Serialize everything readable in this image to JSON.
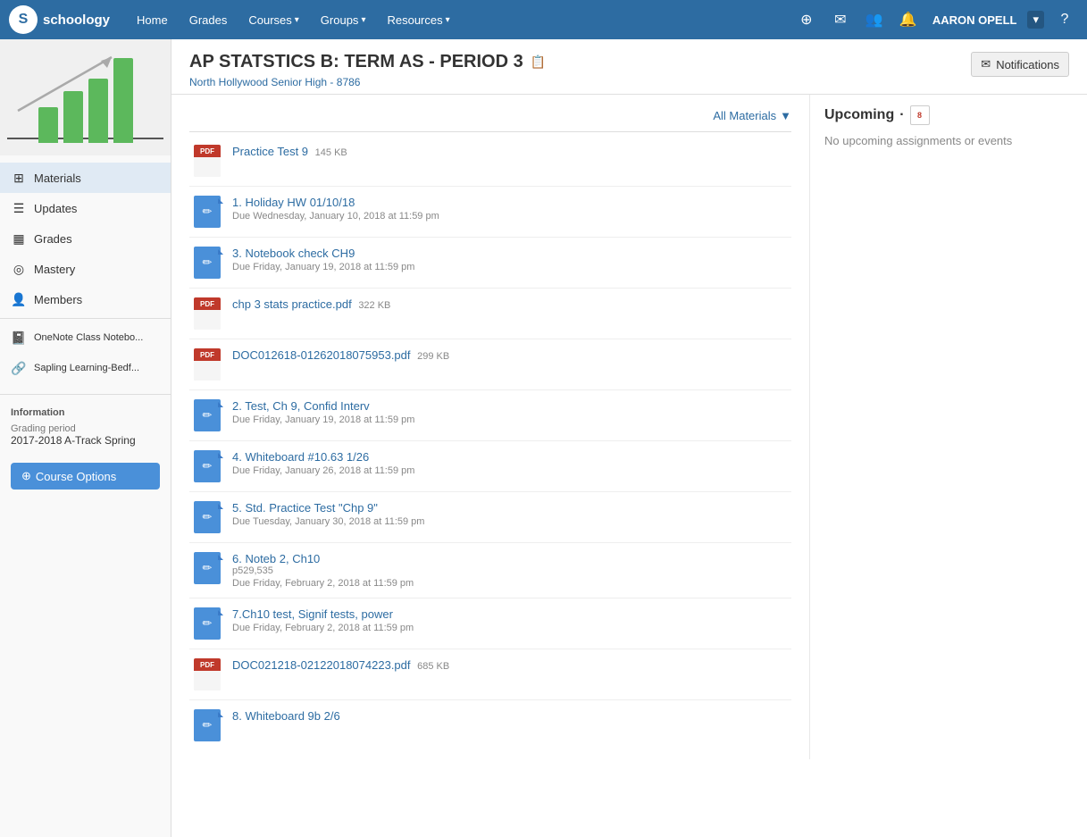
{
  "nav": {
    "logo_text": "schoology",
    "links": [
      {
        "label": "Home",
        "has_dropdown": false
      },
      {
        "label": "Grades",
        "has_dropdown": false
      },
      {
        "label": "Courses",
        "has_dropdown": true
      },
      {
        "label": "Groups",
        "has_dropdown": true
      },
      {
        "label": "Resources",
        "has_dropdown": true
      }
    ],
    "user_name": "AARON OPELL",
    "help_label": "?"
  },
  "course": {
    "title": "AP STATSTICS B: TERM AS - PERIOD 3",
    "school": "North Hollywood Senior High",
    "school_code": "8786",
    "notifications_label": "Notifications"
  },
  "sidebar": {
    "items": [
      {
        "label": "Materials",
        "active": true,
        "icon": "grid"
      },
      {
        "label": "Updates",
        "active": false,
        "icon": "list"
      },
      {
        "label": "Grades",
        "active": false,
        "icon": "table"
      },
      {
        "label": "Mastery",
        "active": false,
        "icon": "circle"
      },
      {
        "label": "Members",
        "active": false,
        "icon": "person"
      },
      {
        "label": "OneNote Class Notebo...",
        "active": false,
        "icon": "note"
      },
      {
        "label": "Sapling Learning-Bedf...",
        "active": false,
        "icon": "link"
      }
    ],
    "info": {
      "label": "Information",
      "grading_period_label": "Grading period",
      "grading_period_value": "2017-2018 A-Track Spring"
    },
    "course_options_label": "Course Options"
  },
  "filter": {
    "label": "All Materials",
    "dropdown_arrow": "▼"
  },
  "materials": [
    {
      "type": "pdf",
      "name": "Practice Test 9",
      "size": "145 KB",
      "due": ""
    },
    {
      "type": "assignment",
      "name": "1. Holiday HW 01/10/18",
      "size": "",
      "due": "Due Wednesday, January 10, 2018 at 11:59 pm"
    },
    {
      "type": "assignment",
      "name": "3. Notebook check CH9",
      "size": "",
      "due": "Due Friday, January 19, 2018 at 11:59 pm"
    },
    {
      "type": "pdf",
      "name": "chp 3 stats practice.pdf",
      "size": "322 KB",
      "due": ""
    },
    {
      "type": "pdf",
      "name": "DOC012618-01262018075953.pdf",
      "size": "299 KB",
      "due": ""
    },
    {
      "type": "assignment",
      "name": "2. Test, Ch 9, Confid Interv",
      "size": "",
      "due": "Due Friday, January 19, 2018 at 11:59 pm"
    },
    {
      "type": "assignment",
      "name": "4. Whiteboard #10.63 1/26",
      "size": "",
      "due": "Due Friday, January 26, 2018 at 11:59 pm"
    },
    {
      "type": "assignment",
      "name": "5. Std. Practice Test \"Chp 9\"",
      "size": "",
      "due": "Due Tuesday, January 30, 2018 at 11:59 pm"
    },
    {
      "type": "assignment",
      "name": "6. Noteb 2, Ch10",
      "size": "",
      "note": "p529,535",
      "due": "Due Friday, February 2, 2018 at 11:59 pm"
    },
    {
      "type": "assignment",
      "name": "7.Ch10 test, Signif tests, power",
      "size": "",
      "due": "Due Friday, February 2, 2018 at 11:59 pm"
    },
    {
      "type": "pdf",
      "name": "DOC021218-02122018074223.pdf",
      "size": "685 KB",
      "due": ""
    },
    {
      "type": "assignment",
      "name": "8. Whiteboard 9b 2/6",
      "size": "",
      "due": ""
    }
  ],
  "upcoming": {
    "label": "Upcoming",
    "calendar_date": "8",
    "empty_message": "No upcoming assignments or events"
  },
  "chart": {
    "bars": [
      {
        "height": 40,
        "color": "#5cb85c"
      },
      {
        "height": 58,
        "color": "#5cb85c"
      },
      {
        "height": 72,
        "color": "#5cb85c"
      },
      {
        "height": 95,
        "color": "#5cb85c"
      }
    ]
  }
}
